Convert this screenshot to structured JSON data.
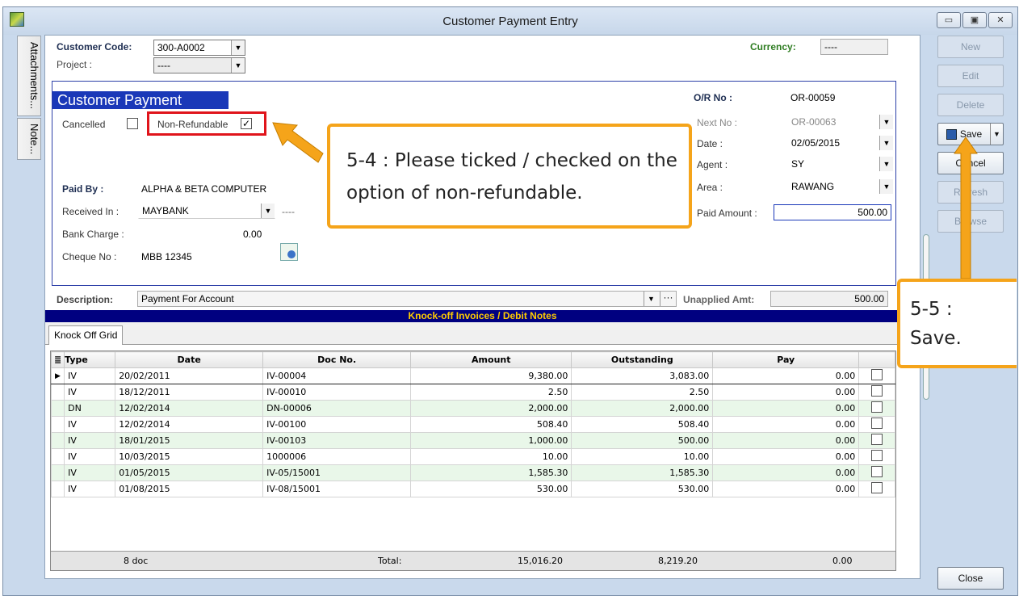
{
  "window": {
    "title": "Customer Payment Entry",
    "min": "▭",
    "max": "▣",
    "close": "✕"
  },
  "side_tabs": [
    "Attachments...",
    "Note..."
  ],
  "header": {
    "customer_code_label": "Customer Code:",
    "customer_code": "300-A0002",
    "project_label": "Project :",
    "project": "----",
    "currency_label": "Currency:",
    "currency": "----"
  },
  "payment": {
    "section_title": "Customer Payment",
    "cancelled_label": "Cancelled",
    "non_refundable_label": "Non-Refundable",
    "non_refundable_checked": "✓",
    "paid_by_label": "Paid By :",
    "paid_by": "ALPHA & BETA COMPUTER",
    "received_in_label": "Received In :",
    "received_in": "MAYBANK",
    "received_in_extra": "----",
    "bank_charge_label": "Bank Charge :",
    "bank_charge": "0.00",
    "cheque_no_label": "Cheque No :",
    "cheque_no": "MBB 12345",
    "or_no_label": "O/R No :",
    "or_no": "OR-00059",
    "next_no_label": "Next No :",
    "next_no": "OR-00063",
    "date_label": "Date :",
    "date": "02/05/2015",
    "agent_label": "Agent :",
    "agent": "SY",
    "area_label": "Area :",
    "area": "RAWANG",
    "paid_amount_label": "Paid Amount :",
    "paid_amount": "500.00"
  },
  "description": {
    "label": "Description:",
    "value": "Payment For Account",
    "unapplied_label": "Unapplied Amt:",
    "unapplied": "500.00"
  },
  "knockoff": {
    "bar_title": "Knock-off Invoices / Debit Notes",
    "tab": "Knock Off Grid",
    "columns": [
      "Type",
      "Date",
      "Doc No.",
      "Amount",
      "Outstanding",
      "Pay"
    ],
    "rows": [
      {
        "type": "IV",
        "date": "20/02/2011",
        "doc": "IV-00004",
        "amount": "9,380.00",
        "outstanding": "3,083.00",
        "pay": "0.00"
      },
      {
        "type": "IV",
        "date": "18/12/2011",
        "doc": "IV-00010",
        "amount": "2.50",
        "outstanding": "2.50",
        "pay": "0.00"
      },
      {
        "type": "DN",
        "date": "12/02/2014",
        "doc": "DN-00006",
        "amount": "2,000.00",
        "outstanding": "2,000.00",
        "pay": "0.00"
      },
      {
        "type": "IV",
        "date": "12/02/2014",
        "doc": "IV-00100",
        "amount": "508.40",
        "outstanding": "508.40",
        "pay": "0.00"
      },
      {
        "type": "IV",
        "date": "18/01/2015",
        "doc": "IV-00103",
        "amount": "1,000.00",
        "outstanding": "500.00",
        "pay": "0.00"
      },
      {
        "type": "IV",
        "date": "10/03/2015",
        "doc": "1000006",
        "amount": "10.00",
        "outstanding": "10.00",
        "pay": "0.00"
      },
      {
        "type": "IV",
        "date": "01/05/2015",
        "doc": "IV-05/15001",
        "amount": "1,585.30",
        "outstanding": "1,585.30",
        "pay": "0.00"
      },
      {
        "type": "IV",
        "date": "01/08/2015",
        "doc": "IV-08/15001",
        "amount": "530.00",
        "outstanding": "530.00",
        "pay": "0.00"
      }
    ],
    "footer": {
      "count": "8 doc",
      "total_label": "Total:",
      "amount": "15,016.20",
      "outstanding": "8,219.20",
      "pay": "0.00"
    }
  },
  "buttons": {
    "new": "New",
    "edit": "Edit",
    "delete": "Delete",
    "save": "Save",
    "cancel": "Cancel",
    "refresh": "Refresh",
    "browse": "Browse",
    "close": "Close"
  },
  "callouts": {
    "step4": "5-4 : Please ticked / checked on the option of non-refundable.",
    "step5_line1": "5-5 :",
    "step5_line2": "Save."
  },
  "colors": {
    "accent": "#f5a41a",
    "highlight": "#e0141b",
    "header_blue": "#1a38b8",
    "navy": "#000080"
  }
}
